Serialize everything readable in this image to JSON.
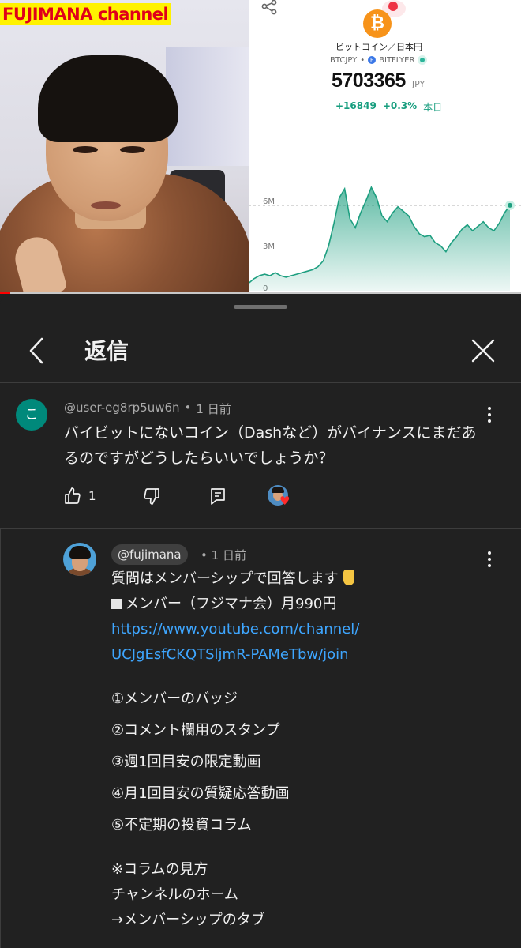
{
  "video": {
    "channel_label": "FUJIMANA channel",
    "progress_fraction": 0.02,
    "chart_panel": {
      "asset_name": "ビットコイン／日本円",
      "pair": "BTCJPY",
      "exchange_icon": "P",
      "exchange": "BITFLYER",
      "price": "5703365",
      "price_unit": "JPY",
      "change_abs": "+16849",
      "change_pct": "+0.3%",
      "change_period": "本日",
      "accent_color": "#1e9f80"
    }
  },
  "chart_data": {
    "type": "area",
    "y_tick_labels": [
      "6M",
      "3M",
      "0"
    ],
    "yticks": [
      6,
      3,
      0
    ],
    "ylim": [
      0,
      7.8
    ],
    "values": [
      0.5,
      0.8,
      1.0,
      1.1,
      1.0,
      1.2,
      1.0,
      0.9,
      1.0,
      1.1,
      1.2,
      1.3,
      1.4,
      1.6,
      2.0,
      3.0,
      4.5,
      6.2,
      6.8,
      4.8,
      4.2,
      5.2,
      6.0,
      6.9,
      6.2,
      5.0,
      4.6,
      5.2,
      5.6,
      5.3,
      5.0,
      4.3,
      3.8,
      3.6,
      3.7,
      3.2,
      3.0,
      2.6,
      3.2,
      3.6,
      4.1,
      4.4,
      4.0,
      4.3,
      4.6,
      4.2,
      4.0,
      4.5,
      5.2,
      5.7
    ],
    "reference_value": 5.7,
    "line_color": "#1e9f80"
  },
  "sheet": {
    "title": "返信",
    "back_icon": "chevron-left-icon",
    "close_icon": "close-icon"
  },
  "parent_comment": {
    "avatar_letter": "こ",
    "avatar_color": "#00897b",
    "author": "@user-eg8rp5uw6n",
    "separator": "•",
    "time": "1 日前",
    "text": "バイビットにないコイン（Dashなど）がバイナンスにまだあるのですがどうしたらいいでしょうか？",
    "like_count": "1",
    "icons": {
      "like": "thumbs-up-icon",
      "dislike": "thumbs-down-icon",
      "reply": "reply-icon",
      "hearted_by": "creator-heart-icon",
      "more": "more-vert-icon"
    }
  },
  "reply": {
    "author": "@fujimana",
    "separator": "•",
    "time": "1 日前",
    "line1": "質問はメンバーシップで回答します",
    "line2": "メンバー（フジマナ会）月990円",
    "link_line1": "https://www.youtube.com/channel/",
    "link_line2": "UCJgEsfCKQTSljmR-PAMeTbw/join",
    "benefits": [
      "①メンバーのバッジ",
      "②コメント欄用のスタンプ",
      "③週1回目安の限定動画",
      "④月1回目安の質疑応答動画",
      "⑤不定期の投資コラム"
    ],
    "note_title": "※コラムの見方",
    "note_line1": "チャンネルのホーム",
    "note_line2": "→メンバーシップのタブ"
  }
}
